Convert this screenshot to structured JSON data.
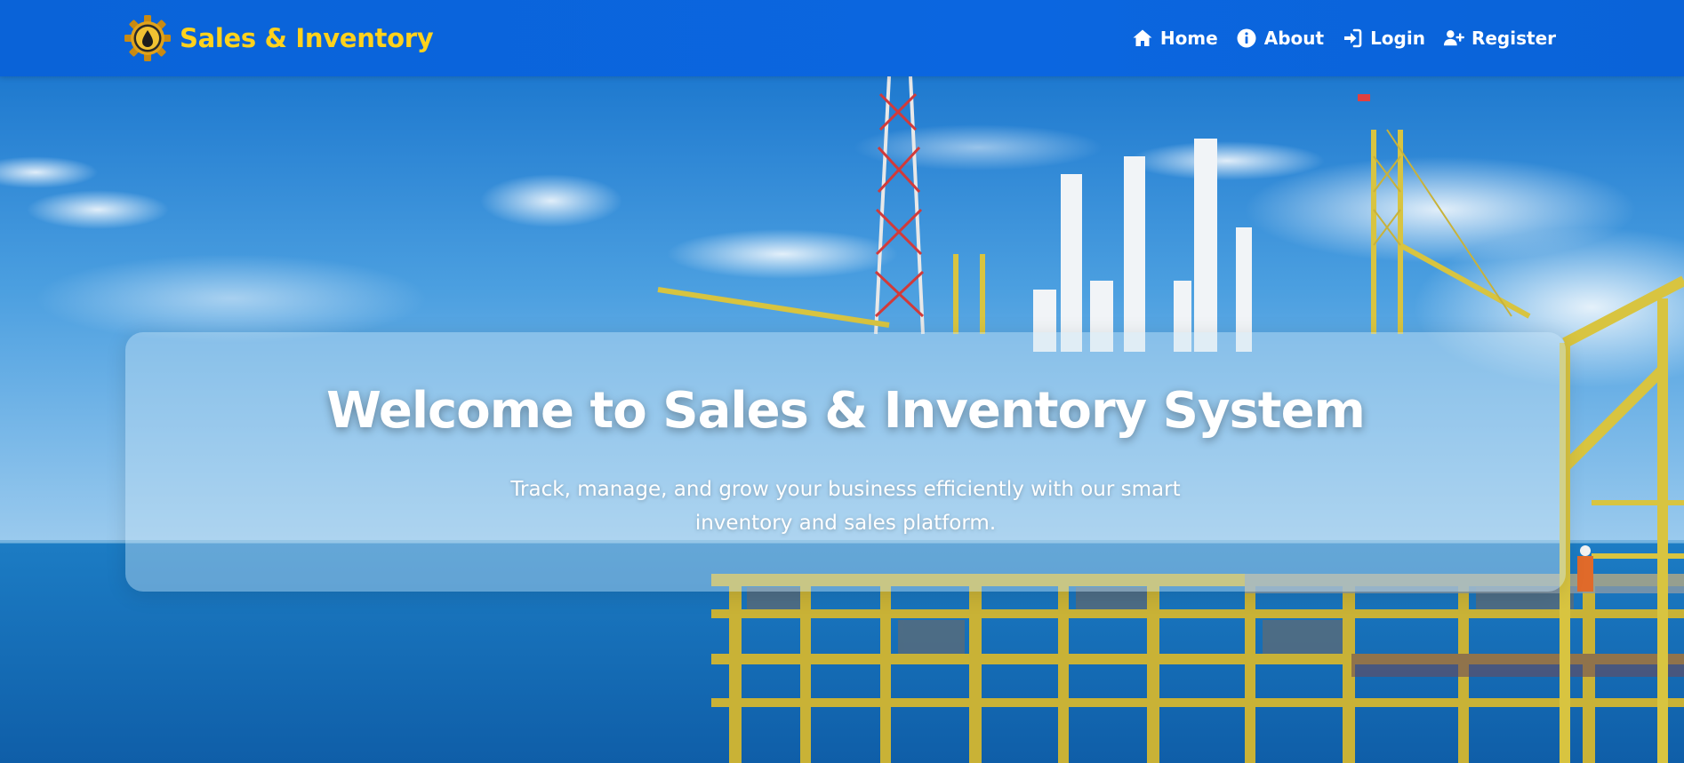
{
  "brand": {
    "name": "Sales & Inventory",
    "logo_icon": "gear-oil-drop-icon",
    "color": "#ffd21c"
  },
  "nav": {
    "items": [
      {
        "label": "Home",
        "icon": "home-icon"
      },
      {
        "label": "About",
        "icon": "info-circle-icon"
      },
      {
        "label": "Login",
        "icon": "sign-in-icon"
      },
      {
        "label": "Register",
        "icon": "user-plus-icon"
      }
    ],
    "background": "#0b66e0"
  },
  "hero": {
    "title": "Welcome to Sales & Inventory System",
    "subtitle": "Track, manage, and grow your business efficiently with our smart inventory and sales platform."
  }
}
